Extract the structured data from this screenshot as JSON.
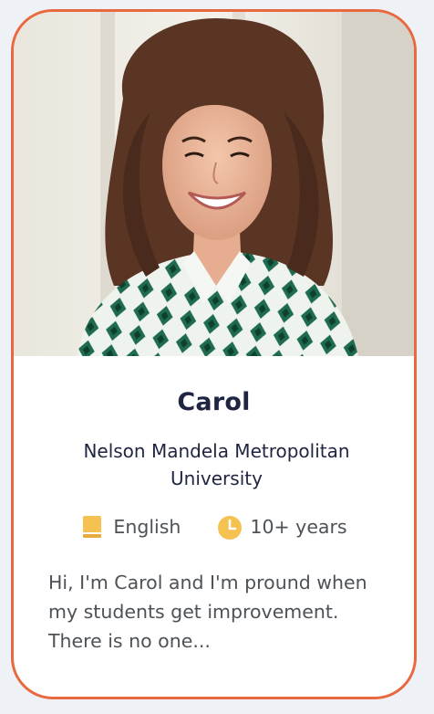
{
  "tutor": {
    "name": "Carol",
    "university": "Nelson Mandela Metropolitan University",
    "language": "English",
    "experience": "10+ years",
    "bio": "Hi, I'm Carol and I'm pround when my students get improvement. There is no one..."
  },
  "icons": {
    "language": "book-icon",
    "experience": "clock-icon"
  },
  "colors": {
    "card_border": "#e8693f",
    "icon_accent": "#f5c150",
    "name_text": "#1f2540",
    "body_text": "#4d5257"
  }
}
